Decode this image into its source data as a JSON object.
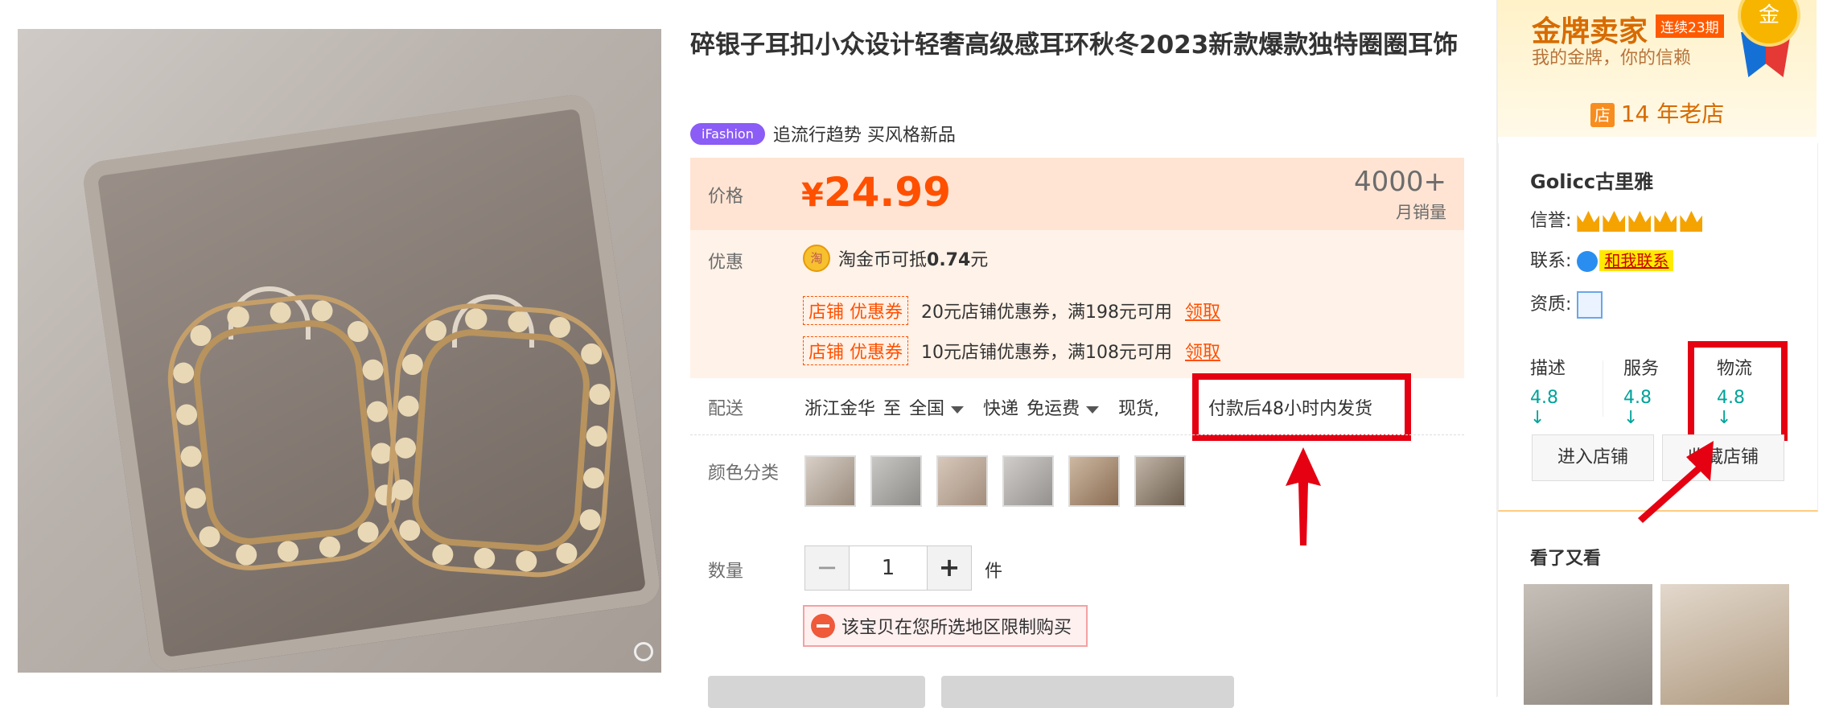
{
  "product": {
    "title": "碎银子耳扣小众设计轻奢高级感耳环秋冬2023新款爆款独特圈圈耳饰",
    "tag_badge": "iFashion",
    "tag_text": "追流行趋势 买风格新品"
  },
  "price": {
    "label": "价格",
    "currency": "¥",
    "value": "24.99",
    "sales_count": "4000+",
    "sales_label": "月销量"
  },
  "promotions": {
    "label": "优惠",
    "coin_icon": "淘",
    "coin_text": "淘金币可抵",
    "coin_amount": "0.74",
    "coin_unit": "元",
    "coupons": [
      {
        "tag": "店铺  优惠券",
        "text": "20元店铺优惠券，满198元可用",
        "action": "领取"
      },
      {
        "tag": "店铺  优惠券",
        "text": "10元店铺优惠券，满108元可用",
        "action": "领取"
      }
    ]
  },
  "delivery": {
    "label": "配送",
    "from": "浙江金华",
    "to_word": "至",
    "destination": "全国",
    "method": "快递",
    "fee": "免运费",
    "stock": "现货,",
    "ship_time": "付款后48小时内发货"
  },
  "color": {
    "label": "颜色分类",
    "swatch_count": 6
  },
  "quantity": {
    "label": "数量",
    "minus": "−",
    "value": "1",
    "plus": "+",
    "unit": "件",
    "warning": "该宝贝在您所选地区限制购买"
  },
  "seller": {
    "gold_title": "金牌卖家",
    "gold_badge": "连续23期",
    "gold_sub": "我的金牌，你的信赖",
    "medal_text": "金",
    "shop_age_icon": "店",
    "shop_age": "14 年老店",
    "shop_name": "Golicc古里雅",
    "reputation_label": "信誉:",
    "contact_label": "联系:",
    "contact_button": "和我联系",
    "qualification_label": "资质:",
    "scores": [
      {
        "label": "描述",
        "value": "4.8 ↓"
      },
      {
        "label": "服务",
        "value": "4.8 ↓"
      },
      {
        "label": "物流",
        "value": "4.8 ↓"
      }
    ],
    "enter_shop": "进入店铺",
    "fav_shop": "收藏店铺"
  },
  "recommend": {
    "title": "看了又看"
  },
  "colors": {
    "accent": "#ff5000",
    "annotation_red": "#e50012",
    "score_green": "#00a39a"
  }
}
